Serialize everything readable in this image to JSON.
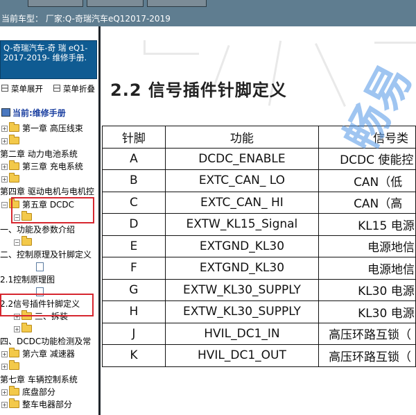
{
  "header": {
    "current_car": "当前车型：  厂家:Q-奇瑞汽车eQ12017-2019"
  },
  "sidebar": {
    "title": "Q-奇瑞汽车-奇 瑞 eQ1-2017-2019- 维修手册.",
    "expand_label": "菜单展开",
    "collapse_label": "菜单折叠",
    "current_label": "当前:维修手册",
    "tree": [
      {
        "label": "第一章 高压线束"
      },
      {
        "label": ""
      },
      {
        "label": "第二章 动力电池系统"
      },
      {
        "label": "第三章 充电系统"
      },
      {
        "label": ""
      },
      {
        "label": "第四章 驱动电机与电机控"
      },
      {
        "label": "第五章 DCDC"
      },
      {
        "label": ""
      },
      {
        "label": "一、功能及参数介绍"
      },
      {
        "label": ""
      },
      {
        "label": "二、控制原理及针脚定义"
      },
      {
        "label": ""
      },
      {
        "label": "2.1控制原理图"
      },
      {
        "label": ""
      },
      {
        "label": "2.2信号插件针脚定义"
      },
      {
        "label": "三、拆装"
      },
      {
        "label": ""
      },
      {
        "label": "四、DCDC功能检测及常"
      },
      {
        "label": "第六章 减速器"
      },
      {
        "label": ""
      },
      {
        "label": "第七章 车辆控制系统"
      },
      {
        "label": "底盘部分"
      },
      {
        "label": "整车电器部分"
      }
    ]
  },
  "content": {
    "heading": "2.2 信号插件针脚定义",
    "watermark": "畅易",
    "table": {
      "headers": [
        "针脚",
        "功能",
        "信号类"
      ],
      "rows": [
        [
          "A",
          "DCDC_ENABLE",
          "DCDC 使能控"
        ],
        [
          "B",
          "EXTC_CAN_ LO",
          "CAN（低"
        ],
        [
          "C",
          "EXTC_CAN_ HI",
          "CAN（高"
        ],
        [
          "D",
          "EXTW_KL15_Signal",
          "KL15 电源"
        ],
        [
          "E",
          "EXTGND_KL30",
          "电源地信"
        ],
        [
          "F",
          "EXTGND_KL30",
          "电源地信"
        ],
        [
          "G",
          "EXTW_KL30_SUPPLY",
          "KL30 电源"
        ],
        [
          "H",
          "EXTW_KL30_SUPPLY",
          "KL30 电源"
        ],
        [
          "J",
          "HVIL_DC1_IN",
          "高压环路互锁（"
        ],
        [
          "K",
          "HVIL_DC1_OUT",
          "高压环路互锁（"
        ]
      ]
    }
  },
  "colors": {
    "topbar": "#5f7d90",
    "sidebar_title_bg": "#0f5b92",
    "highlight_box": "#d6262f",
    "watermark": "#5096e6"
  }
}
